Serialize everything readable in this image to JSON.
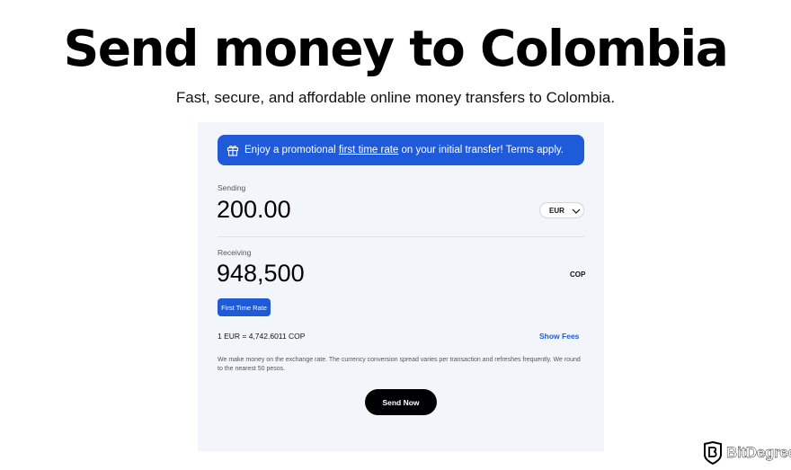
{
  "hero": {
    "title": "Send money to Colombia",
    "subtitle": "Fast, secure, and affordable online money transfers to Colombia."
  },
  "promo": {
    "prefix": "Enjoy a promotional ",
    "link": "first time rate",
    "suffix": " on your initial transfer! Terms apply.",
    "icon": "gift-icon"
  },
  "sending": {
    "label": "Sending",
    "amount": "200.00",
    "currency": "EUR"
  },
  "receiving": {
    "label": "Receiving",
    "amount": "948,500",
    "currency": "COP"
  },
  "rate_badge": "First Time Rate",
  "exchange_rate": "1 EUR = 4,742.6011 COP",
  "show_fees": "Show Fees",
  "disclaimer": "We make money on the exchange rate. The currency conversion spread varies per transaction and refreshes frequently. We round to the nearest 50 pesos.",
  "send_button": "Send Now",
  "brand": {
    "name": "BitDegree"
  },
  "colors": {
    "accent": "#1f5bd8",
    "card_bg": "#f2f6fa",
    "button": "#000000"
  }
}
